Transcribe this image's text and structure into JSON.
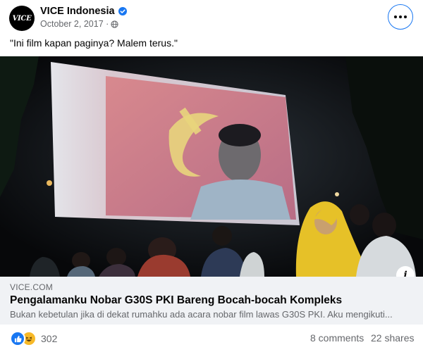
{
  "post": {
    "page_name": "VICE Indonesia",
    "avatar_text": "VICE",
    "date": "October 2, 2017",
    "caption": "\"Ini film kapan paginya? Malem terus.\""
  },
  "icons": {
    "verified": "verified-badge-icon",
    "privacy": "globe-icon",
    "more": "more-options-icon",
    "info": "info-icon",
    "like": "like-reaction-icon",
    "haha": "haha-reaction-icon"
  },
  "link_preview": {
    "domain": "VICE.COM",
    "title": "Pengalamanku Nobar G30S PKI Bareng Bocah-bocah Kompleks",
    "description": "Bukan kebetulan jika di dekat rumahku ada acara nobar film lawas G30S PKI. Aku mengikuti...",
    "info_glyph": "i"
  },
  "engagement": {
    "reaction_count": "302",
    "comments": "8 comments",
    "shares": "22 shares"
  },
  "colors": {
    "accent": "#1877f2",
    "secondary_text": "#65676b",
    "preview_bg": "#f0f2f5"
  }
}
